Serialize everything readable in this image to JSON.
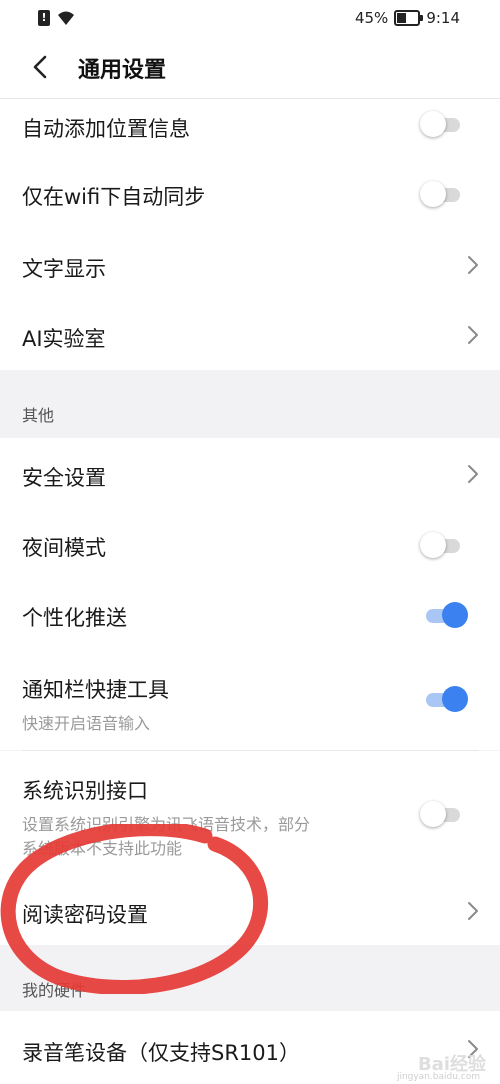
{
  "status_bar": {
    "battery_percent": "45%",
    "time": "9:14",
    "icons": [
      "sim-icon",
      "wifi-icon",
      "battery-icon"
    ]
  },
  "header": {
    "title": "通用设置",
    "back_icon": "chevron-left-icon"
  },
  "rows": [
    {
      "label": "自动添加位置信息",
      "control": "toggle",
      "on": false
    },
    {
      "label": "仅在wifi下自动同步",
      "control": "toggle",
      "on": false
    },
    {
      "label": "文字显示",
      "control": "chevron"
    },
    {
      "label": "AI实验室",
      "control": "chevron"
    }
  ],
  "section_other": {
    "title": "其他",
    "rows": [
      {
        "label": "安全设置",
        "control": "chevron"
      },
      {
        "label": "夜间模式",
        "control": "toggle",
        "on": false
      },
      {
        "label": "个性化推送",
        "control": "toggle",
        "on": true
      },
      {
        "label": "通知栏快捷工具",
        "sublabel": "快速开启语音输入",
        "control": "toggle",
        "on": true
      },
      {
        "label": "系统识别接口",
        "sublabel_line1": "设置系统识别引擎为讯飞语音技术，部分",
        "sublabel_line2": "系统版本不支持此功能",
        "control": "toggle",
        "on": false
      },
      {
        "label": "阅读密码设置",
        "control": "chevron"
      }
    ]
  },
  "section_hardware": {
    "title": "我的硬件",
    "rows": [
      {
        "label": "录音笔设备（仅支持SR101）",
        "control": "chevron"
      }
    ]
  },
  "colors": {
    "accent": "#3b82f0",
    "annotation": "#e53935"
  },
  "watermark": {
    "text": "Bai经验",
    "sub": "jingyan.baidu.com"
  }
}
